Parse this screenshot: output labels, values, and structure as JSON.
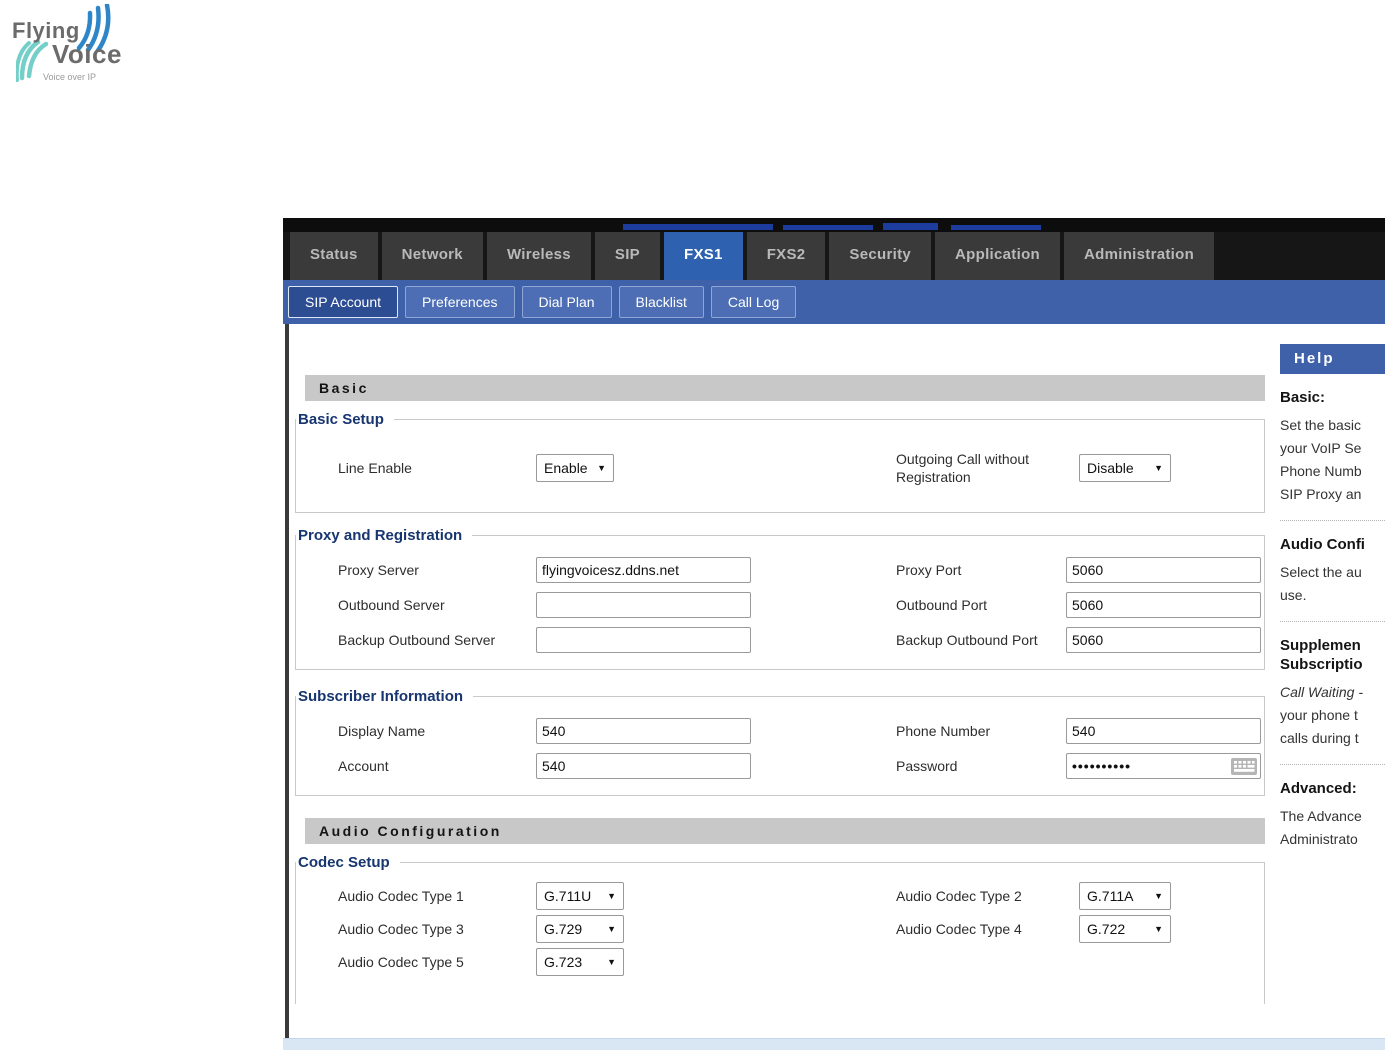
{
  "logo": {
    "word1": "Flying",
    "word2": "Voice",
    "tagline": "Voice over IP"
  },
  "nav": {
    "tabs": [
      "Status",
      "Network",
      "Wireless",
      "SIP",
      "FXS1",
      "FXS2",
      "Security",
      "Application",
      "Administration"
    ],
    "active_tab": "FXS1",
    "subtabs": [
      "SIP Account",
      "Preferences",
      "Dial Plan",
      "Blacklist",
      "Call Log"
    ],
    "active_subtab": "SIP Account"
  },
  "sections": {
    "basic": "Basic",
    "audio": "Audio Configuration"
  },
  "basic_setup": {
    "legend": "Basic Setup",
    "line_enable": {
      "label": "Line Enable",
      "value": "Enable"
    },
    "outgoing": {
      "label": "Outgoing Call without Registration",
      "value": "Disable"
    }
  },
  "proxy": {
    "legend": "Proxy and Registration",
    "proxy_server": {
      "label": "Proxy Server",
      "value": "flyingvoicesz.ddns.net"
    },
    "proxy_port": {
      "label": "Proxy Port",
      "value": "5060"
    },
    "outbound_server": {
      "label": "Outbound Server",
      "value": ""
    },
    "outbound_port": {
      "label": "Outbound Port",
      "value": "5060"
    },
    "backup_outbound_server": {
      "label": "Backup Outbound Server",
      "value": ""
    },
    "backup_outbound_port": {
      "label": "Backup Outbound Port",
      "value": "5060"
    }
  },
  "subscriber": {
    "legend": "Subscriber Information",
    "display_name": {
      "label": "Display Name",
      "value": "540"
    },
    "phone_number": {
      "label": "Phone Number",
      "value": "540"
    },
    "account": {
      "label": "Account",
      "value": "540"
    },
    "password": {
      "label": "Password",
      "value": "••••••••••"
    }
  },
  "codec": {
    "legend": "Codec Setup",
    "type1": {
      "label": "Audio Codec Type 1",
      "value": "G.711U"
    },
    "type2": {
      "label": "Audio Codec Type 2",
      "value": "G.711A"
    },
    "type3": {
      "label": "Audio Codec Type 3",
      "value": "G.729"
    },
    "type4": {
      "label": "Audio Codec Type 4",
      "value": "G.722"
    },
    "type5": {
      "label": "Audio Codec Type 5",
      "value": "G.723"
    }
  },
  "help": {
    "title": "Help",
    "s1_title": "Basic:",
    "s1_l1": "Set the basic",
    "s1_l2": "your VoIP Se",
    "s1_l3": "Phone Numb",
    "s1_l4": "SIP Proxy an",
    "s2_title": "Audio Confi",
    "s2_l1": "Select the au",
    "s2_l2": "use.",
    "s3_title1": "Supplemen",
    "s3_title2": "Subscriptio",
    "s3_italic": "Call Waiting -",
    "s3_l1": "your phone t",
    "s3_l2": "calls during t",
    "s4_title": "Advanced:",
    "s4_l1": "The Advance",
    "s4_l2": "Administrato"
  },
  "icons": {
    "select_arrow": "▼"
  },
  "colors": {
    "active_tab": "#2e62b1",
    "nav_blue": "#3e61a9",
    "section_bar": "#c8c8c8",
    "legend_text": "#17356f",
    "logo_blue": "#2e86c8",
    "logo_teal": "#74cfc9",
    "bottom_band": "#d9e7f5"
  }
}
